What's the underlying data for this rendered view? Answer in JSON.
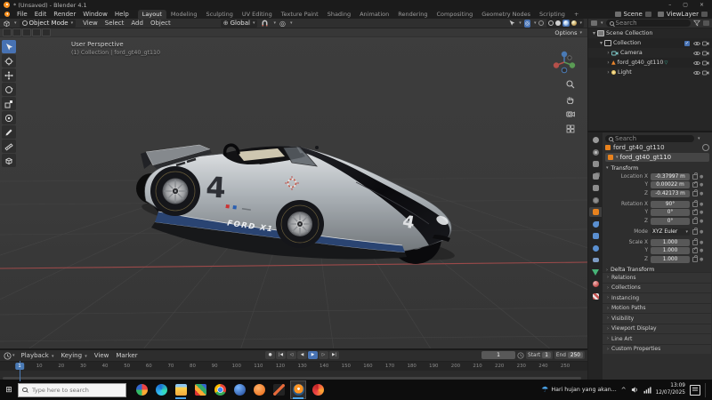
{
  "window": {
    "title": "* (Unsaved) - Blender 4.1"
  },
  "topbar": {
    "menus": [
      "File",
      "Edit",
      "Render",
      "Window",
      "Help"
    ],
    "workspaces": [
      "Layout",
      "Modeling",
      "Sculpting",
      "UV Editing",
      "Texture Paint",
      "Shading",
      "Animation",
      "Rendering",
      "Compositing",
      "Geometry Nodes",
      "Scripting",
      "+"
    ],
    "active_workspace": "Layout",
    "scene_label": "Scene",
    "view_layer_label": "ViewLayer"
  },
  "viewport_header": {
    "mode_label": "Object Mode",
    "menus": [
      "View",
      "Select",
      "Add",
      "Object"
    ],
    "orientation_label": "Global"
  },
  "viewport": {
    "options_label": "Options",
    "perspective_label": "User Perspective",
    "collection_label": "(1) Collection | ford_gt40_gt110",
    "tools": [
      "select-box-tool",
      "cursor-tool",
      "move-tool",
      "rotate-tool",
      "scale-tool",
      "transform-tool",
      "annotate-tool",
      "measure-tool",
      "add-cube-tool"
    ],
    "tool_settings_icons": [
      "tool-settings-icon-1",
      "tool-settings-icon-2",
      "tool-settings-icon-3",
      "tool-settings-icon-4",
      "tool-settings-icon-5"
    ],
    "car": {
      "number": "4",
      "livery_text": "FORD X1"
    }
  },
  "outliner": {
    "search_placeholder": "Search",
    "items": [
      {
        "label": "Scene Collection",
        "depth": 0,
        "icon": "scene-collection-icon",
        "expand": "open",
        "right": []
      },
      {
        "label": "Collection",
        "depth": 1,
        "icon": "collection-icon",
        "expand": "open",
        "right": [
          "checkbox",
          "eye",
          "camera"
        ]
      },
      {
        "label": "Camera",
        "depth": 2,
        "icon": "camera-object-icon",
        "expand": "closed",
        "right": [
          "eye",
          "camera"
        ]
      },
      {
        "label": "ford_gt40_gt110",
        "depth": 2,
        "icon": "mesh-object-icon",
        "badge": "geometry-nodes-icon",
        "expand": "closed",
        "right": [
          "eye",
          "camera"
        ]
      },
      {
        "label": "Light",
        "depth": 2,
        "icon": "light-object-icon",
        "expand": "closed",
        "right": [
          "eye",
          "camera"
        ]
      }
    ]
  },
  "properties": {
    "search_placeholder": "Search",
    "breadcrumb": "ford_gt40_gt110",
    "object_name": "ford_gt40_gt110",
    "tabs": [
      {
        "name": "tool"
      },
      {
        "name": "render"
      },
      {
        "name": "output"
      },
      {
        "name": "view-layer"
      },
      {
        "name": "scene"
      },
      {
        "name": "world"
      },
      {
        "name": "object",
        "active": true
      },
      {
        "name": "modifiers"
      },
      {
        "name": "particles"
      },
      {
        "name": "physics"
      },
      {
        "name": "constraints"
      },
      {
        "name": "data"
      },
      {
        "name": "material"
      },
      {
        "name": "texture"
      }
    ],
    "transform_title": "Transform",
    "transform_rows": [
      {
        "label": "Location X",
        "value": "-0.37997 m"
      },
      {
        "label": "Y",
        "value": "0.00022 m"
      },
      {
        "label": "Z",
        "value": "-0.42173 m"
      },
      {
        "label": "Rotation X",
        "value": "90°",
        "gap": true
      },
      {
        "label": "Y",
        "value": "0°"
      },
      {
        "label": "Z",
        "value": "0°"
      },
      {
        "label": "Mode",
        "value": "XYZ Euler",
        "type": "dropdown",
        "gap": true
      },
      {
        "label": "Scale X",
        "value": "1.000",
        "gap": true
      },
      {
        "label": "Y",
        "value": "1.000"
      },
      {
        "label": "Z",
        "value": "1.000"
      }
    ],
    "delta_label": "Delta Transform",
    "sections": [
      "Relations",
      "Collections",
      "Instancing",
      "Motion Paths",
      "Visibility",
      "Viewport Display",
      "Line Art",
      "Custom Properties"
    ]
  },
  "timeline": {
    "menus": [
      "Playback",
      "Keying",
      "View",
      "Marker"
    ],
    "playback_buttons": [
      {
        "name": "jump-to-start",
        "glyph": "|◀"
      },
      {
        "name": "previous-keyframe",
        "glyph": "◁"
      },
      {
        "name": "play-reverse",
        "glyph": "◀"
      },
      {
        "name": "play",
        "glyph": "▶"
      },
      {
        "name": "next-keyframe",
        "glyph": "▷"
      },
      {
        "name": "jump-to-end",
        "glyph": "▶|"
      }
    ],
    "current_frame": "1",
    "start_label": "Start",
    "start_value": "1",
    "end_label": "End",
    "end_value": "250",
    "ticks": [
      "10",
      "20",
      "30",
      "40",
      "50",
      "60",
      "70",
      "80",
      "90",
      "100",
      "110",
      "120",
      "130",
      "140",
      "150",
      "160",
      "170",
      "180",
      "190",
      "200",
      "210",
      "220",
      "230",
      "240",
      "250"
    ]
  },
  "taskbar": {
    "search_placeholder": "Type here to search",
    "apps": [
      {
        "name": "pinwheel-app-icon"
      },
      {
        "name": "edge-icon"
      },
      {
        "name": "file-explorer-icon",
        "open": true
      },
      {
        "name": "blocks-app-icon"
      },
      {
        "name": "chrome-icon"
      },
      {
        "name": "blue-swirl-app-icon"
      },
      {
        "name": "orange-app-icon"
      },
      {
        "name": "slash-app-icon"
      },
      {
        "name": "blender-icon",
        "open": true,
        "active": true
      },
      {
        "name": "red-circle-app-icon"
      }
    ],
    "weather_text": "Hari hujan yang akan...",
    "time": "13:09",
    "date": "12/07/2025"
  }
}
